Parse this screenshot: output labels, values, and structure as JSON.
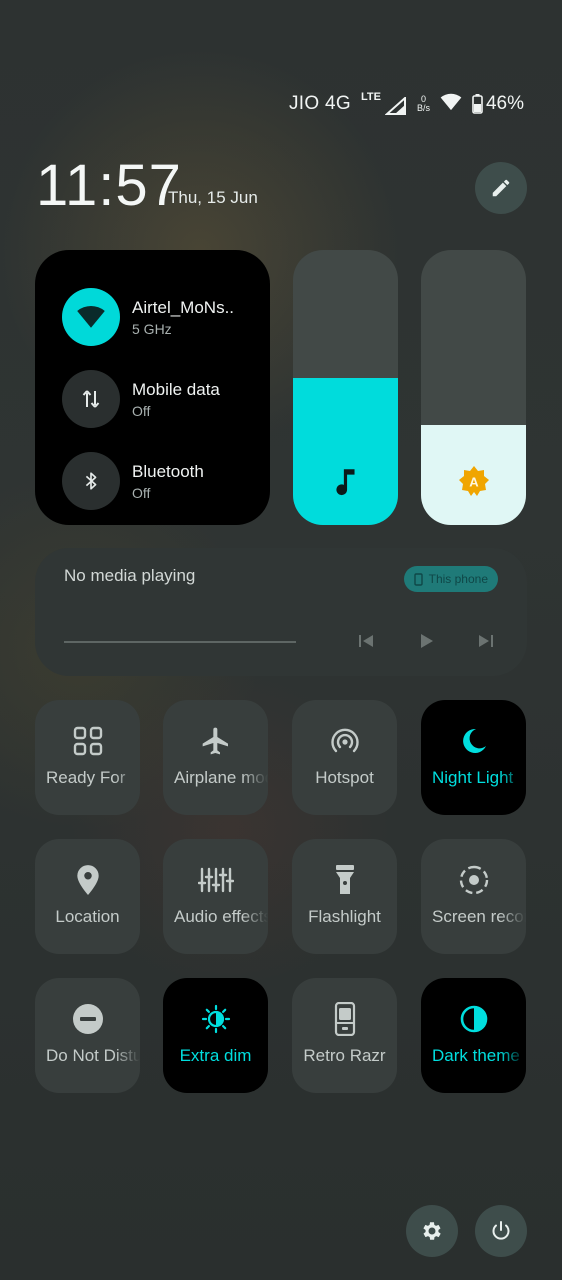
{
  "status_bar": {
    "carrier": "JIO 4G",
    "network_type": "LTE",
    "speed_value": "0",
    "speed_unit": "B/s",
    "battery_percent": "46%"
  },
  "header": {
    "time": "11:57",
    "date": "Thu, 15 Jun"
  },
  "connectivity": {
    "wifi": {
      "title": "Airtel_MoNs..",
      "subtitle": "5 GHz",
      "icon": "wifi-icon",
      "active": true
    },
    "mobile_data": {
      "title": "Mobile data",
      "subtitle": "Off",
      "icon": "swap-vertical-icon",
      "active": false
    },
    "bluetooth": {
      "title": "Bluetooth",
      "subtitle": "Off",
      "icon": "bluetooth-icon",
      "active": false
    }
  },
  "sliders": {
    "volume": {
      "level": 0.535,
      "icon": "music-note-icon",
      "color": "#00dcdc"
    },
    "brightness": {
      "level": 0.365,
      "icon": "auto-brightness-icon",
      "color": "#e0f7f5"
    }
  },
  "media": {
    "title": "No media playing",
    "output": "This phone",
    "progress": 0
  },
  "tiles": [
    {
      "label": "Ready For",
      "icon": "grid-icon",
      "on": false
    },
    {
      "label": "Airplane mode",
      "icon": "airplane-icon",
      "on": false
    },
    {
      "label": "Hotspot",
      "icon": "hotspot-icon",
      "on": false
    },
    {
      "label": "Night Light",
      "icon": "moon-icon",
      "on": true
    },
    {
      "label": "Location",
      "icon": "location-pin-icon",
      "on": false
    },
    {
      "label": "Audio effects",
      "icon": "equalizer-icon",
      "on": false
    },
    {
      "label": "Flashlight",
      "icon": "flashlight-icon",
      "on": false
    },
    {
      "label": "Screen record",
      "icon": "screen-record-icon",
      "on": false
    },
    {
      "label": "Do Not Disturb",
      "icon": "do-not-disturb-icon",
      "on": false
    },
    {
      "label": "Extra dim",
      "icon": "extra-dim-icon",
      "on": true
    },
    {
      "label": "Retro Razr",
      "icon": "flip-phone-icon",
      "on": false
    },
    {
      "label": "Dark theme",
      "icon": "dark-theme-icon",
      "on": true
    }
  ],
  "colors": {
    "accent": "#00dcdc",
    "tile_off": "#383e3d",
    "tile_on": "#000000",
    "button_bg": "#3e4d4b"
  }
}
